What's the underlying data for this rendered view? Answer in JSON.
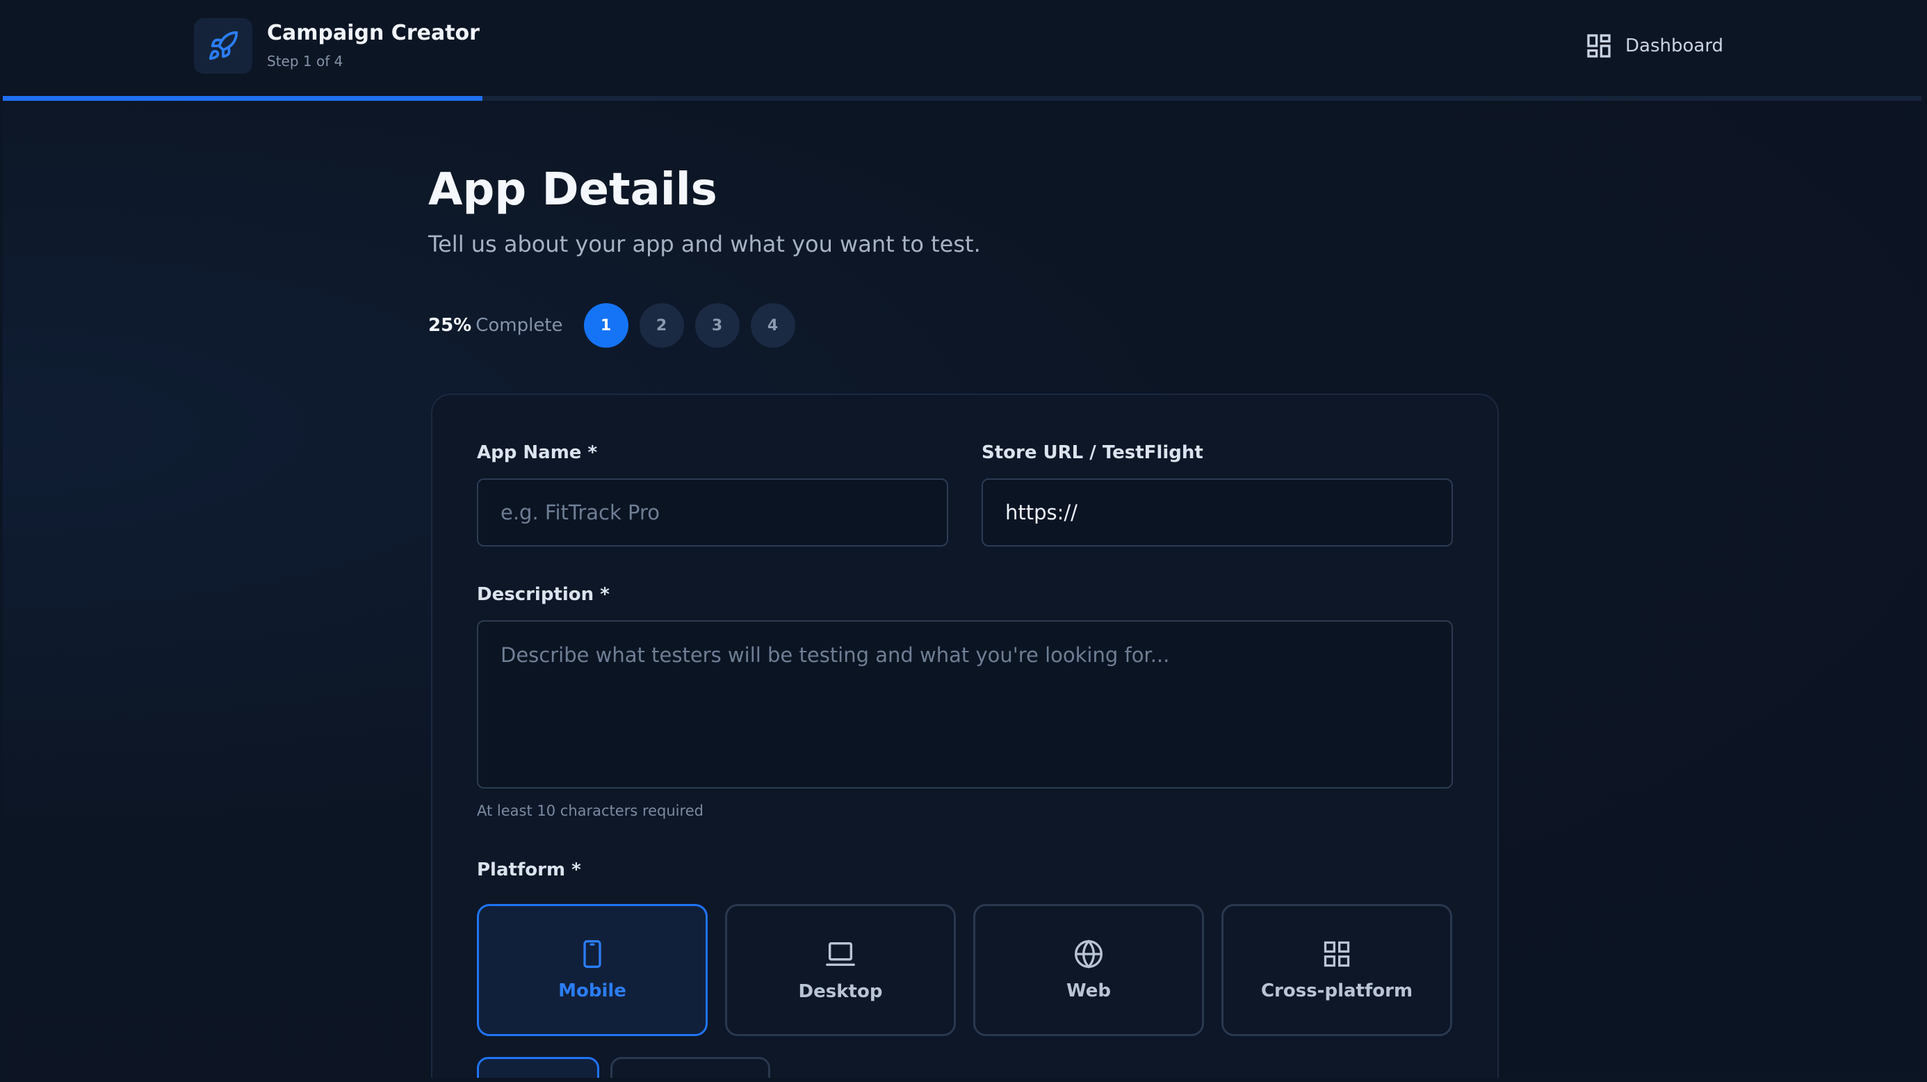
{
  "header": {
    "app_title": "Campaign Creator",
    "step_text": "Step 1 of 4",
    "dashboard_label": "Dashboard",
    "progress_fraction": 0.25
  },
  "page": {
    "title": "App Details",
    "subtitle": "Tell us about your app and what you want to test."
  },
  "steps": {
    "percent": "25%",
    "percent_word": "Complete",
    "items": [
      "1",
      "2",
      "3",
      "4"
    ],
    "active": 0
  },
  "form": {
    "app_name": {
      "label": "App Name *",
      "placeholder": "e.g. FitTrack Pro",
      "value": ""
    },
    "store_url": {
      "label": "Store URL / TestFlight",
      "placeholder": "",
      "value": "https://"
    },
    "description": {
      "label": "Description *",
      "placeholder": "Describe what testers will be testing and what you're looking for...",
      "hint": "At least 10 characters required"
    },
    "platform": {
      "label": "Platform *",
      "options": [
        {
          "label": "Mobile",
          "icon": "smartphone-icon",
          "selected": true
        },
        {
          "label": "Desktop",
          "icon": "laptop-icon",
          "selected": false
        },
        {
          "label": "Web",
          "icon": "globe-icon",
          "selected": false
        },
        {
          "label": "Cross-platform",
          "icon": "grid-icon",
          "selected": false
        }
      ]
    }
  },
  "colors": {
    "accent": "#1f74f5",
    "background": "#0c1524",
    "card": "#0d1728",
    "border": "#2a384e"
  }
}
